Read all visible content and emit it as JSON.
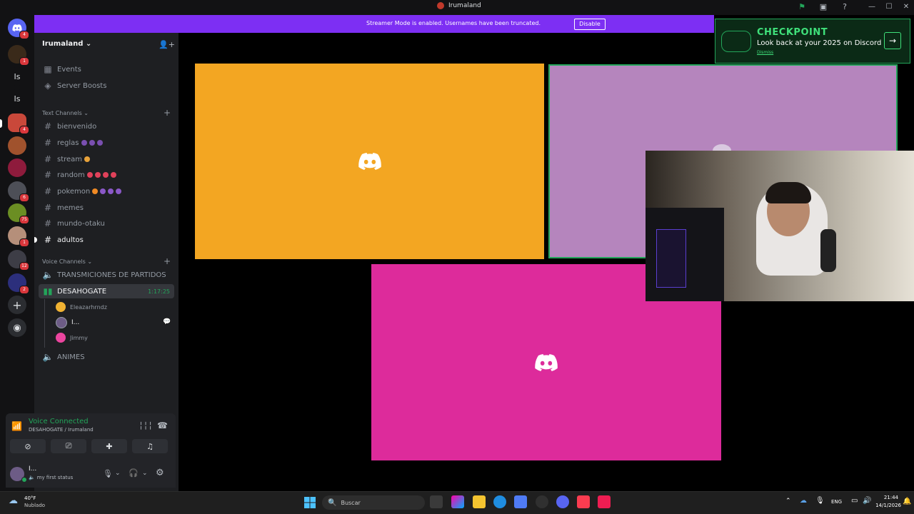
{
  "window": {
    "title": "Irumaland"
  },
  "banner": {
    "message": "Streamer Mode is enabled. Usernames have been truncated.",
    "button": "Disable"
  },
  "checkpoint": {
    "title": "CHECKPOINT",
    "subtitle": "Look back at your 2025 on Discord",
    "dismiss": "Dismiss"
  },
  "rail": {
    "home_badge": "4",
    "items": [
      {
        "label": "",
        "badge": "1"
      },
      {
        "label": "Is",
        "badge": ""
      },
      {
        "label": "Is",
        "badge": ""
      },
      {
        "label": "",
        "badge": "4"
      },
      {
        "label": "",
        "badge": ""
      },
      {
        "label": "",
        "badge": ""
      },
      {
        "label": "",
        "badge": "6"
      },
      {
        "label": "",
        "badge": "75"
      },
      {
        "label": "",
        "badge": "1"
      },
      {
        "label": "",
        "badge": "12"
      },
      {
        "label": "",
        "badge": "2"
      }
    ]
  },
  "server": {
    "name": "Irumaland"
  },
  "sidebar": {
    "events": "Events",
    "boosts": "Server Boosts",
    "text_category": "Text Channels",
    "text_channels": [
      {
        "name": "bienvenido"
      },
      {
        "name": "reglas"
      },
      {
        "name": "stream"
      },
      {
        "name": "random"
      },
      {
        "name": "pokemon"
      },
      {
        "name": "memes"
      },
      {
        "name": "mundo-otaku"
      },
      {
        "name": "adultos"
      }
    ],
    "voice_category": "Voice Channels",
    "voice_channels": {
      "v1": "TRANSMICIONES DE PARTIDOS",
      "v2": "DESAHOGATE",
      "v2_timer": "1:17:25",
      "v3": "ANIMES"
    },
    "voice_users": [
      "Eleazarhrndz",
      "I...",
      "Jimmy"
    ]
  },
  "voice_panel": {
    "status": "Voice Connected",
    "channel": "DESAHOGATE / Irumaland"
  },
  "user_panel": {
    "name": "I...",
    "status": "my first status"
  },
  "taskbar": {
    "weather_temp": "40°F",
    "weather_desc": "Nublado",
    "search_placeholder": "Buscar",
    "lang": "ENG",
    "time": "21:44",
    "date": "14/1/2026"
  },
  "colors": {
    "tile1": "#f3a622",
    "tile2": "#b585bd",
    "tile3": "#dd2b9b",
    "brand": "#7d2ff3",
    "connected": "#23a55a"
  }
}
